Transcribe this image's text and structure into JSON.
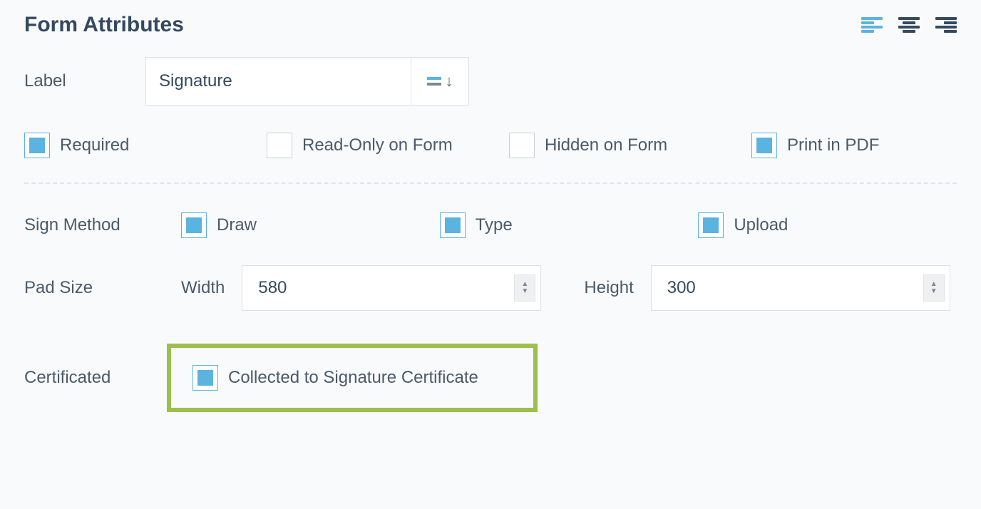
{
  "section": {
    "title": "Form Attributes"
  },
  "label_field": {
    "title": "Label",
    "value": "Signature"
  },
  "options": {
    "required": {
      "label": "Required",
      "checked": true
    },
    "readonly": {
      "label": "Read-Only on Form",
      "checked": false
    },
    "hidden": {
      "label": "Hidden on Form",
      "checked": false
    },
    "print_pdf": {
      "label": "Print in PDF",
      "checked": true
    }
  },
  "sign_method": {
    "title": "Sign Method",
    "draw": {
      "label": "Draw",
      "checked": true
    },
    "type": {
      "label": "Type",
      "checked": true
    },
    "upload": {
      "label": "Upload",
      "checked": true
    }
  },
  "pad_size": {
    "title": "Pad Size",
    "width_label": "Width",
    "height_label": "Height",
    "width": "580",
    "height": "300"
  },
  "certificated": {
    "title": "Certificated",
    "collect": {
      "label": "Collected to Signature Certificate",
      "checked": true
    }
  }
}
